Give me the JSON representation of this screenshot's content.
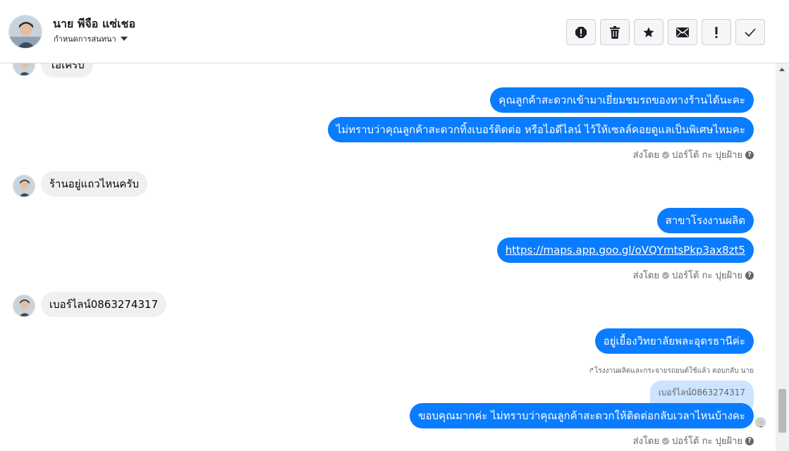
{
  "header": {
    "contact_name": "นาย พีจือ แซ่เชอ",
    "assign_label": "กำหนดการสนทนา",
    "actions": [
      "spam-icon",
      "trash-icon",
      "star-icon",
      "envelope-icon",
      "exclamation-icon",
      "check-icon"
    ]
  },
  "messages": {
    "in_0": "โอเครับ",
    "out_1": "คุณลูกค้าสะดวกเข้ามาเยี่ยมชมรถของทางร้านได้นะคะ",
    "out_2": "ไม่ทราบว่าคุณลูกค้าสะดวกทิ้งเบอร์ติดต่อ หรือไอดีไลน์ ไว้ให้เซลล์คอยดูแลเป็นพิเศษไหมคะ",
    "in_3": "ร้านอยู่แถวไหนครับ",
    "out_4": "สาขาโรงงานผลิต",
    "out_5_link": "https://maps.app.goo.gl/oVQYmtsPkp3ax8zt5",
    "in_6": "เบอร์ไลน์0863274317",
    "out_7": "อยู่เยื้องวิทยาลัยพละอุดรธานีค่ะ",
    "reply_note": "↱โรงงานผลิตและกระจายรถยนต์ใช้แล้ว ตอบกลับ นาย",
    "reply_quote": "เบอร์ไลน์0863274317",
    "out_8": "ขอบคุณมากค่ะ ไม่ทราบว่าคุณลูกค้าสะดวกให้ติดต่อกลับเวลาไหนบ้างคะ"
  },
  "sent_by": {
    "prefix": "ส่งโดย",
    "agent": "ปอร์โต้ กะ ปุยฝ้าย"
  },
  "colors": {
    "outgoing_bubble": "#0a7cff",
    "incoming_bubble": "#f0f0f0",
    "reply_quote": "#cce4ff"
  }
}
